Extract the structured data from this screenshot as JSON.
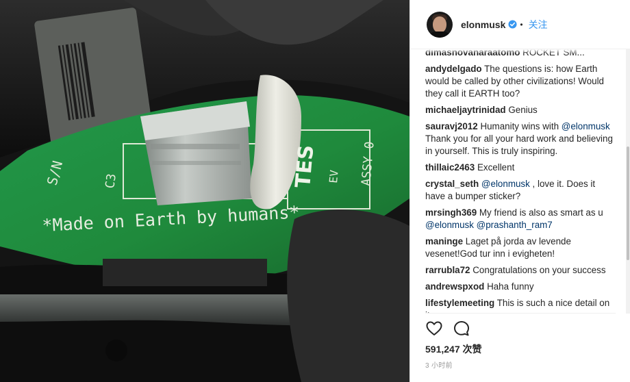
{
  "header": {
    "username": "elonmusk",
    "separator": "•",
    "follow_label": "关注",
    "verified_icon": "verified-badge-icon",
    "avatar_icon": "profile-avatar"
  },
  "photo": {
    "alt": "circuit board photo",
    "engraved_text": "*Made on Earth by humans*",
    "label_sn": "S/N",
    "label_c3": "C3",
    "label_assy": "ASSY 0",
    "label_ev": "EV",
    "label_tes": "TES"
  },
  "comments": [
    {
      "user": "dimasnovanaraatomo",
      "parts": [
        {
          "t": "text",
          "v": "ROCKET SM..."
        }
      ]
    },
    {
      "user": "andydelgado",
      "parts": [
        {
          "t": "text",
          "v": "The questions is: how Earth would be called by other civilizations! Would they call it EARTH too?"
        }
      ]
    },
    {
      "user": "michaeljaytrinidad",
      "parts": [
        {
          "t": "text",
          "v": "Genius"
        }
      ]
    },
    {
      "user": "sauravj2012",
      "parts": [
        {
          "t": "text",
          "v": "Humanity wins with "
        },
        {
          "t": "mention",
          "v": "@elonmusk"
        },
        {
          "t": "text",
          "v": " Thank you for all your hard work and believing in yourself. This is truly inspiring."
        }
      ]
    },
    {
      "user": "thillaic2463",
      "parts": [
        {
          "t": "text",
          "v": "Excellent"
        }
      ]
    },
    {
      "user": "crystal_seth",
      "parts": [
        {
          "t": "mention",
          "v": "@elonmusk"
        },
        {
          "t": "text",
          "v": " , love it. Does it have a bumper sticker?"
        }
      ]
    },
    {
      "user": "mrsingh369",
      "parts": [
        {
          "t": "text",
          "v": "My friend is also as smart as u "
        },
        {
          "t": "mention",
          "v": "@elonmusk"
        },
        {
          "t": "text",
          "v": " "
        },
        {
          "t": "mention",
          "v": "@prashanth_ram7"
        }
      ]
    },
    {
      "user": "maninge",
      "parts": [
        {
          "t": "text",
          "v": "Laget på jorda av levende vesenet!God tur inn i evigheten!"
        }
      ]
    },
    {
      "user": "rarrubla72",
      "parts": [
        {
          "t": "text",
          "v": "Congratulations on your success"
        }
      ]
    },
    {
      "user": "andrewspxod",
      "parts": [
        {
          "t": "text",
          "v": "Haha funny"
        }
      ]
    },
    {
      "user": "lifestylemeeting",
      "parts": [
        {
          "t": "text",
          "v": "This is such a nice detail on it"
        }
      ]
    }
  ],
  "actions": {
    "like_icon": "heart-icon",
    "comment_icon": "comment-bubble-icon"
  },
  "likes": {
    "count": "591,247",
    "label": "次赞"
  },
  "timestamp": "3 小时前",
  "colors": {
    "link": "#3897f0",
    "mention": "#003569",
    "verified": "#3897f0",
    "board_green": "#1f8a3c"
  }
}
